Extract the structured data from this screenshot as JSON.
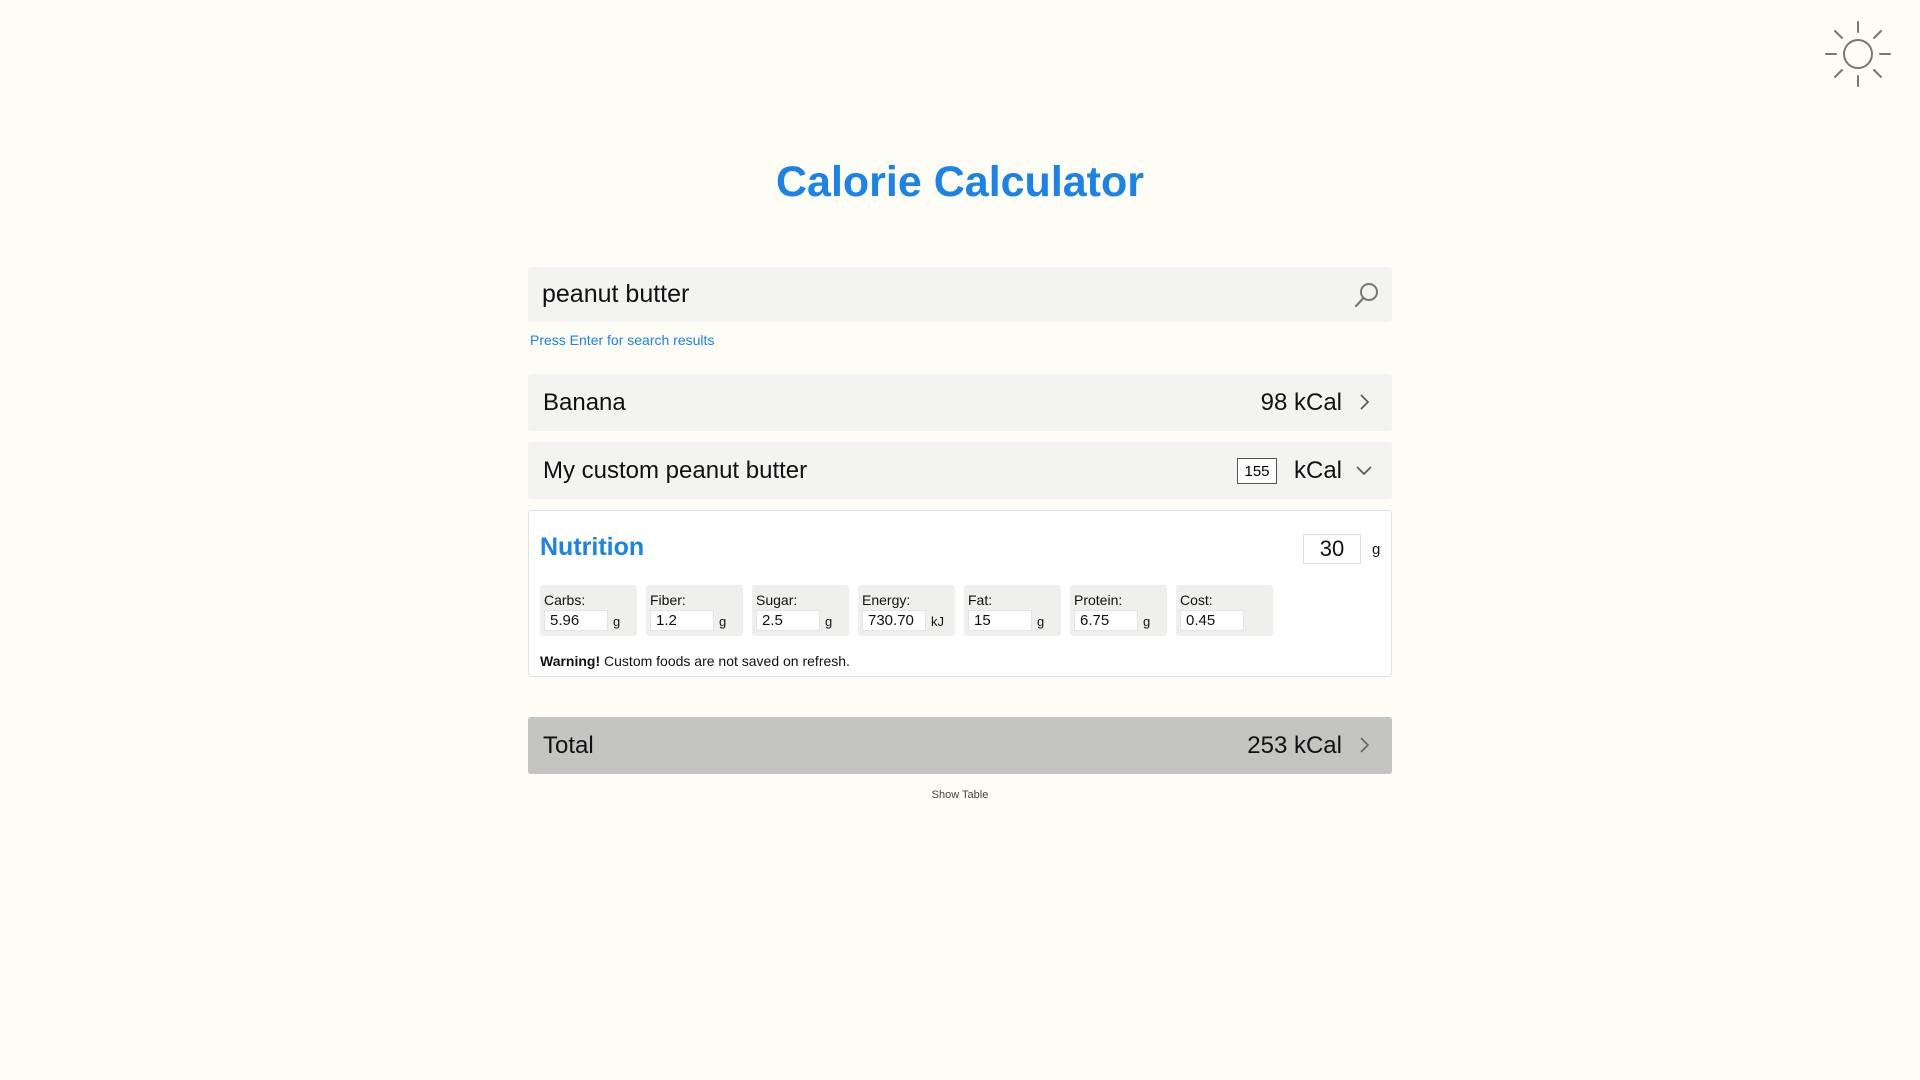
{
  "app": {
    "title": "Calorie Calculator",
    "theme_toggle_icon": "sun-icon"
  },
  "search": {
    "value": "peanut butter",
    "icon": "search-icon",
    "hint": "Press Enter for search results"
  },
  "foods": [
    {
      "name": "Banana",
      "kcal": "98 kCal",
      "icon": "chevron-right-icon"
    },
    {
      "name": "My custom peanut butter",
      "kcal_value": "155",
      "kcal_unit": "kCal",
      "icon": "chevron-down-icon"
    }
  ],
  "nutrition": {
    "title": "Nutrition",
    "grams": "30",
    "grams_unit": "g",
    "items": [
      {
        "label": "Carbs:",
        "value": "5.96",
        "unit": "g"
      },
      {
        "label": "Fiber:",
        "value": "1.2",
        "unit": "g"
      },
      {
        "label": "Sugar:",
        "value": "2.5",
        "unit": "g"
      },
      {
        "label": "Energy:",
        "value": "730.70",
        "unit": "kJ"
      },
      {
        "label": "Fat:",
        "value": "15",
        "unit": "g"
      },
      {
        "label": "Protein:",
        "value": "6.75",
        "unit": "g"
      },
      {
        "label": "Cost:",
        "value": "0.45",
        "unit": ""
      }
    ],
    "warning_bold": "Warning!",
    "warning_text": " Custom foods are not saved on refresh."
  },
  "total": {
    "label": "Total",
    "kcal": "253 kCal",
    "icon": "chevron-right-icon"
  },
  "show_table": "Show Table",
  "colors": {
    "accent": "#1a82e8",
    "background": "#fdfdf5",
    "row_bg": "#f3f3f2",
    "total_bg": "#c4c4c3"
  }
}
